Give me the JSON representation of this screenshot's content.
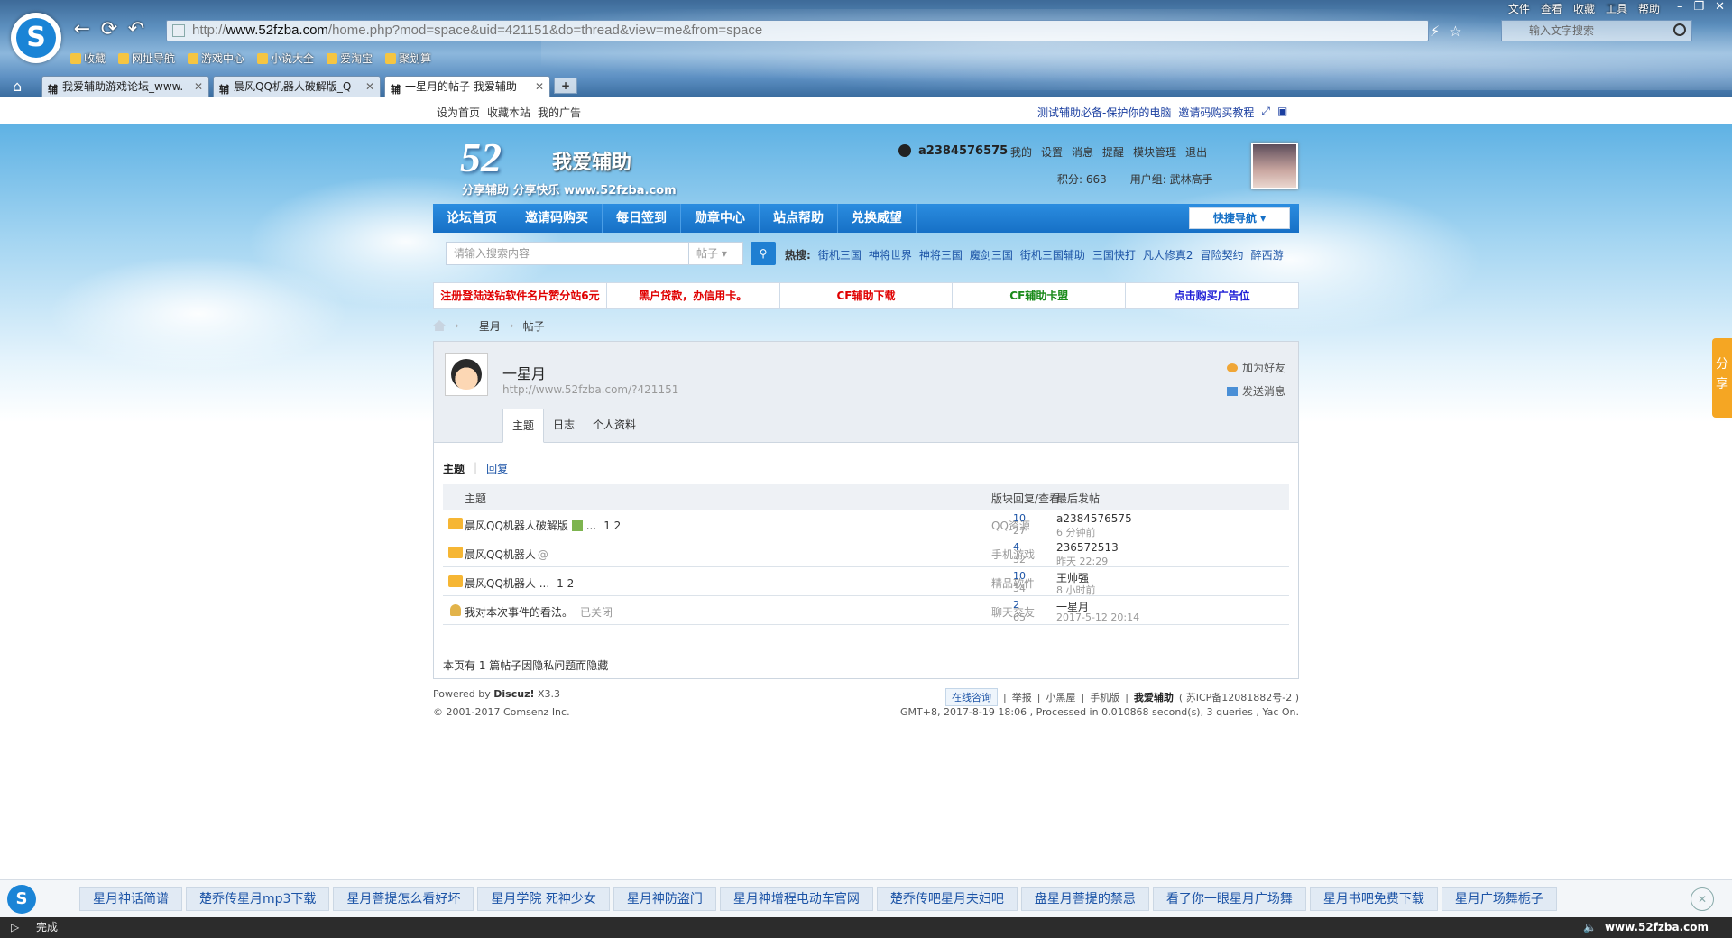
{
  "browser": {
    "url_prefix": "http://",
    "url_domain": "www.52fzba.com",
    "url_rest": "/home.php?mod=space&uid=421151&do=thread&view=me&from=space",
    "search_placeholder": "输入文字搜索",
    "menu": [
      "文件",
      "查看",
      "收藏",
      "工具",
      "帮助"
    ],
    "bookmarks": [
      "收藏",
      "网址导航",
      "游戏中心",
      "小说大全",
      "爱淘宝",
      "聚划算"
    ],
    "tabs": [
      {
        "title": "我爱辅助游戏论坛_www.",
        "fav": "辅"
      },
      {
        "title": "晨风QQ机器人破解版_Q",
        "fav": "辅"
      },
      {
        "title": "一星月的帖子 我爱辅助",
        "fav": "辅"
      }
    ]
  },
  "site": {
    "topbar_left": [
      "设为首页",
      "收藏本站",
      "我的广告"
    ],
    "topbar_right": [
      "测试辅助必备-保护你的电脑",
      "邀请码购买教程"
    ],
    "logo_num": "52",
    "logo_name": "我爱辅助",
    "slogan": "分享辅助  分享快乐  www.52fzba.com",
    "user": {
      "name": "a2384576575",
      "links": [
        "我的",
        "设置",
        "消息",
        "提醒",
        "模块管理",
        "退出"
      ],
      "credits": "积分: 663",
      "group": "用户组: 武林高手"
    },
    "nav": [
      "论坛首页",
      "邀请码购买",
      "每日签到",
      "勋章中心",
      "站点帮助",
      "兑换威望"
    ],
    "quick_nav": "快捷导航",
    "search": {
      "placeholder": "请输入搜索内容",
      "type": "帖子",
      "hot_label": "热搜:",
      "hot": [
        "街机三国",
        "神将世界",
        "神将三国",
        "魔剑三国",
        "街机三国辅助",
        "三国快打",
        "凡人修真2",
        "冒险契约",
        "醉西游"
      ]
    },
    "ads": [
      {
        "text": "注册登陆送钻软件名片赞分站6元",
        "color": "#e00000"
      },
      {
        "text": "黑户贷款，办信用卡。",
        "color": "#e00000"
      },
      {
        "text": "CF辅助下载",
        "color": "#e00000"
      },
      {
        "text": "CF辅助卡盟",
        "color": "#1a8a1a"
      },
      {
        "text": "点击购买广告位",
        "color": "#1f1fd6"
      }
    ],
    "breadcrumb": [
      "一星月",
      "帖子"
    ]
  },
  "profile": {
    "name": "一星月",
    "url": "http://www.52fzba.com/?421151",
    "actions": [
      "加为好友",
      "发送消息"
    ],
    "tabs": [
      "主题",
      "日志",
      "个人资料"
    ],
    "subtabs": [
      "主题",
      "回复"
    ],
    "columns": [
      "主题",
      "版块",
      "回复/查看",
      "最后发帖"
    ],
    "rows": [
      {
        "title": "晨风QQ机器人破解版",
        "ext": "...",
        "pages": "1 2",
        "forum": "QQ资源",
        "replies": "10",
        "views": "27",
        "lp_user": "a2384576575",
        "lp_time": "6 分钟前"
      },
      {
        "title": "晨风QQ机器人",
        "ext": "",
        "pages": "",
        "forum": "手机游戏",
        "replies": "4",
        "views": "32",
        "lp_user": "236572513",
        "lp_time": "昨天 22:29"
      },
      {
        "title": "晨风QQ机器人 ...",
        "ext": "",
        "pages": "1 2",
        "forum": "精品软件",
        "replies": "10",
        "views": "34",
        "lp_user": "王帅强",
        "lp_time": "8 小时前"
      },
      {
        "title": "我对本次事件的看法。",
        "ext": "已关闭",
        "pages": "",
        "forum": "聊天交友",
        "replies": "2",
        "views": "65",
        "lp_user": "一星月",
        "lp_time": "2017-5-12 20:14"
      }
    ],
    "hidden_note": "本页有 1 篇帖子因隐私问题而隐藏"
  },
  "footer": {
    "powered": "Powered by",
    "powered_b": "Discuz!",
    "powered_v": "X3.3",
    "copyright": "© 2001-2017 Comsenz Inc.",
    "consult": "在线咨询",
    "links": [
      "举报",
      "小黑屋",
      "手机版"
    ],
    "site_b": "我爱辅助",
    "icp": "( 苏ICP备12081882号-2 )",
    "stats": "GMT+8, 2017-8-19 18:06 , Processed in 0.010868 second(s), 3 queries , Yac On."
  },
  "share": "分享",
  "recommend": [
    "星月神话简谱",
    "楚乔传星月mp3下载",
    "星月菩提怎么看好坏",
    "星月学院 死神少女",
    "星月神防盗门",
    "星月神增程电动车官网",
    "楚乔传吧星月夫妇吧",
    "盘星月菩提的禁忌",
    "看了你一眼星月广场舞",
    "星月书吧免费下载",
    "星月广场舞栀子"
  ],
  "status": {
    "text": "完成",
    "watermark": "www.52fzba.com"
  }
}
